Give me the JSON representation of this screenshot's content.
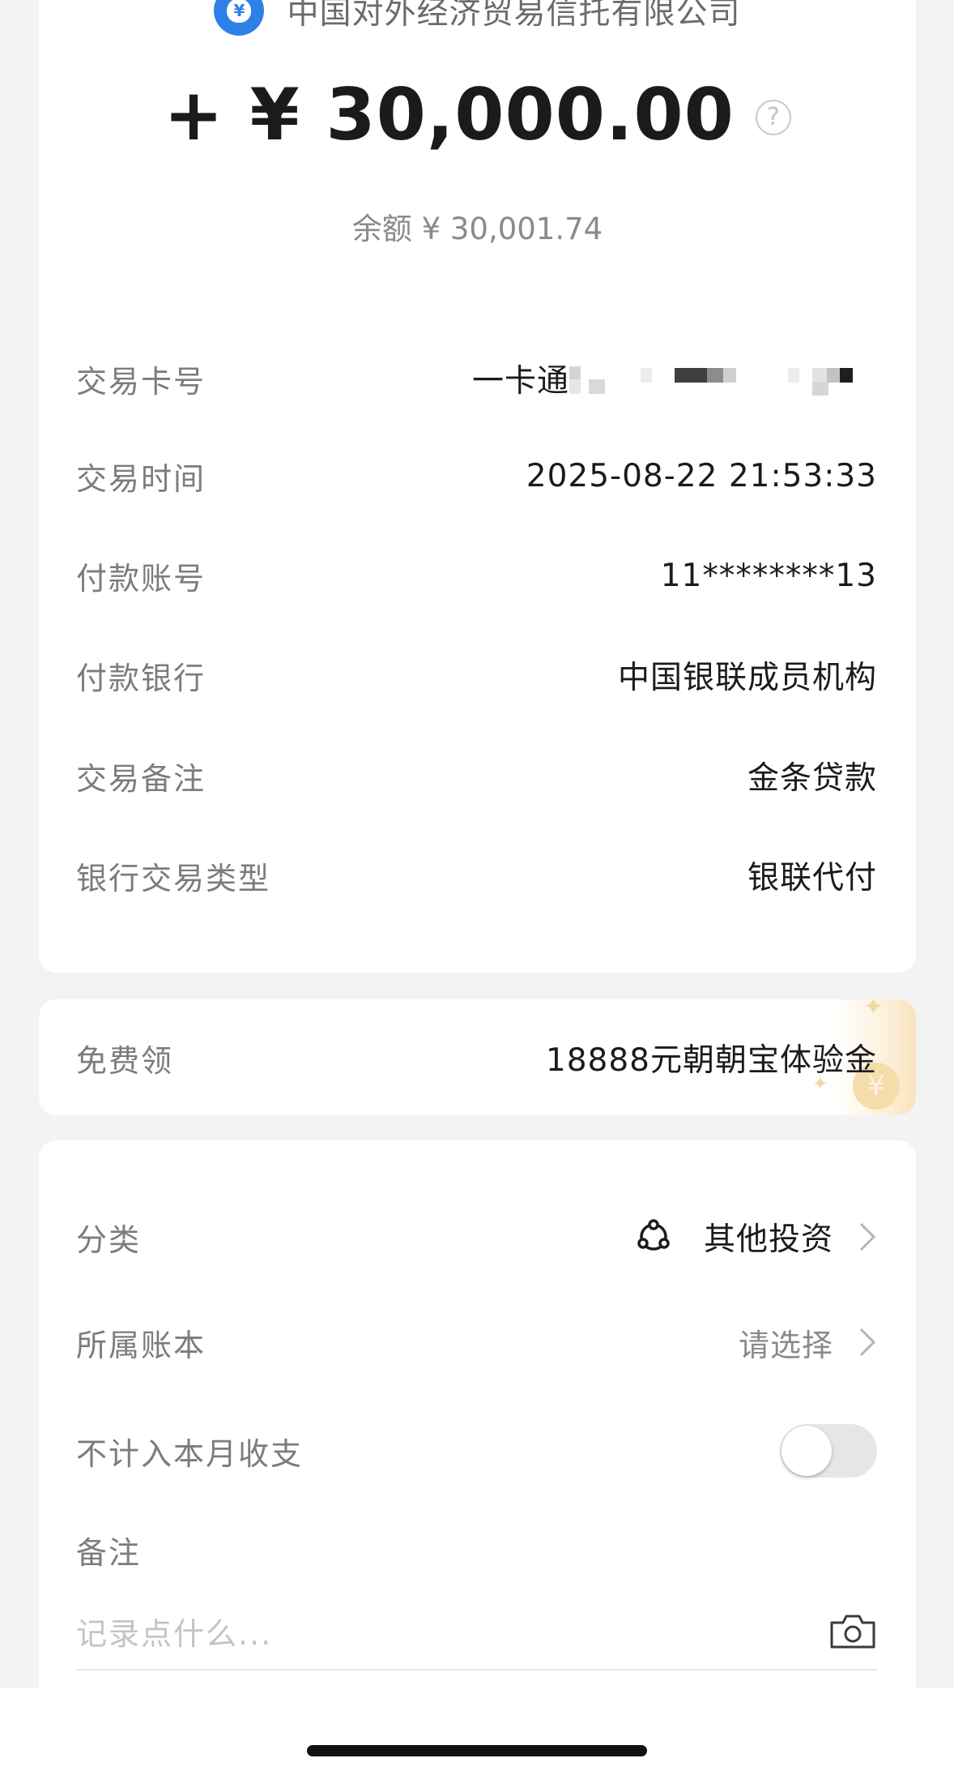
{
  "transaction": {
    "merchant_name": "中国对外经济贸易信托有限公司",
    "merchant_icon": "money-bag-icon",
    "merchant_icon_glyph": "¥",
    "amount": "+ ¥ 30,000.00",
    "help_glyph": "?",
    "balance": "余额 ¥ 30,001.74"
  },
  "details": {
    "card_label": "交易卡号",
    "card_value": "一卡通",
    "time_label": "交易时间",
    "time_value": "2025-08-22 21:53:33",
    "payer_account_label": "付款账号",
    "payer_account_value": "11********13",
    "payer_bank_label": "付款银行",
    "payer_bank_value": "中国银联成员机构",
    "remark_label": "交易备注",
    "remark_value": "金条贷款",
    "type_label": "银行交易类型",
    "type_value": "银联代付"
  },
  "promo": {
    "label": "免费领",
    "value": "18888元朝朝宝体验金",
    "coin_glyph": "¥"
  },
  "settings": {
    "category_label": "分类",
    "category_value": "其他投资",
    "category_icon": "investment-icon",
    "ledger_label": "所属账本",
    "ledger_value": "请选择",
    "exclude_label": "不计入本月收支",
    "exclude_enabled": false,
    "note_label": "备注",
    "note_placeholder": "记录点什么...",
    "camera_icon": "camera-icon"
  }
}
